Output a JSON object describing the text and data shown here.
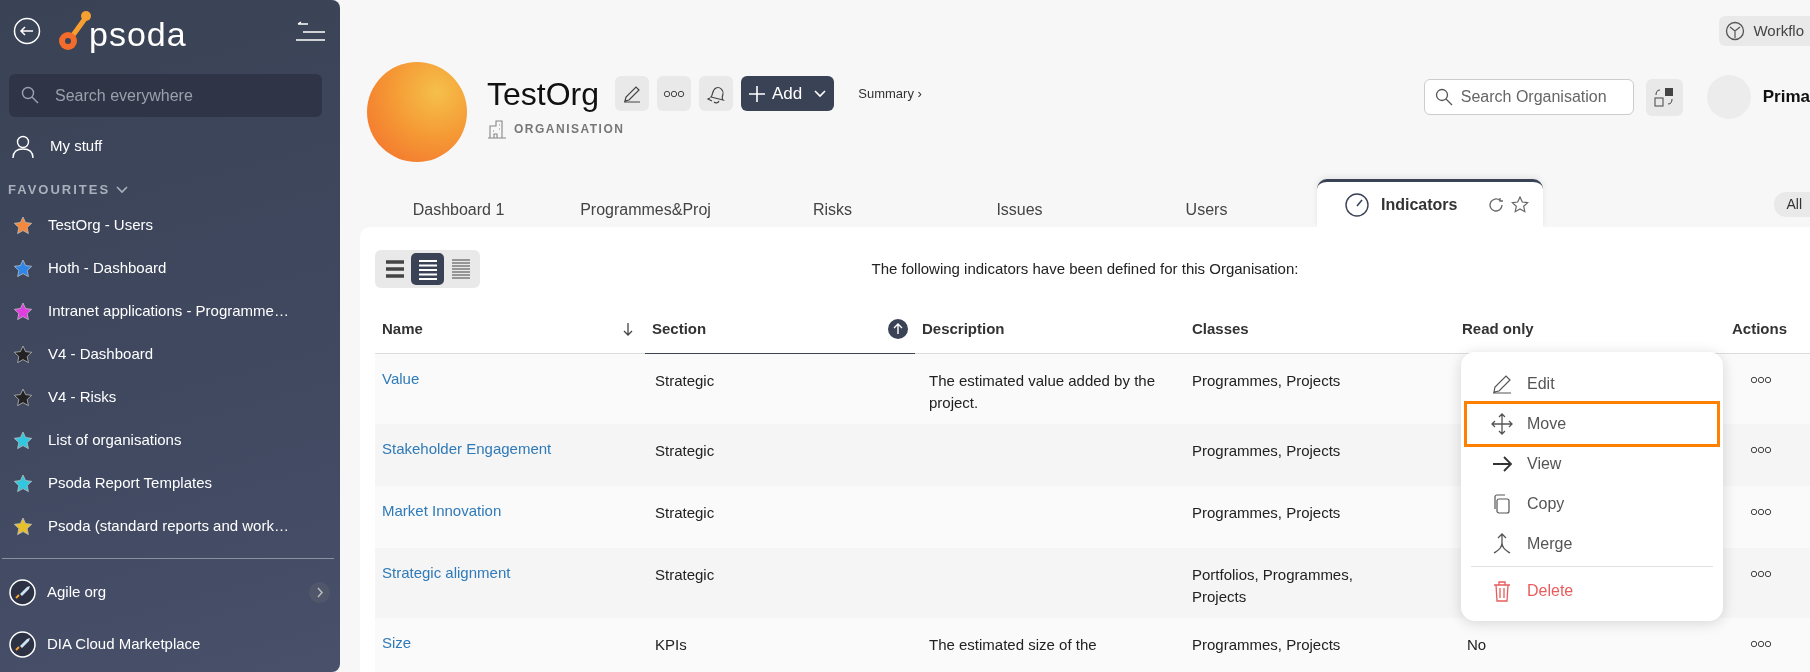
{
  "sidebar": {
    "logo": "psoda",
    "search": {
      "placeholder": "Search everywhere"
    },
    "my_stuff": "My stuff",
    "favourites_heading": "FAVOURITES",
    "favourites": [
      {
        "label": "TestOrg - Users",
        "color": "#f5883a"
      },
      {
        "label": "Hoth - Dashboard",
        "color": "#2e86e8"
      },
      {
        "label": "Intranet applications - Programme…",
        "color": "#e03ee0"
      },
      {
        "label": "V4 - Dashboard",
        "color": "#222222"
      },
      {
        "label": "V4 - Risks",
        "color": "#222222"
      },
      {
        "label": "List of organisations",
        "color": "#30c8e0"
      },
      {
        "label": "Psoda Report Templates",
        "color": "#30c8e0"
      },
      {
        "label": "Psoda (standard reports and work…",
        "color": "#e8c02a"
      }
    ],
    "organisations": [
      {
        "label": "Agile org",
        "expandable": true
      },
      {
        "label": "DIA Cloud Marketplace",
        "expandable": false
      }
    ]
  },
  "header": {
    "workflow_button": "Workflo",
    "title": "TestOrg",
    "type": "ORGANISATION",
    "add_button": "Add",
    "summary_link": "Summary ›",
    "search": {
      "placeholder": "Search Organisation"
    },
    "user_name": "Prima"
  },
  "tabs": [
    {
      "label": "Dashboard 1",
      "selected": false
    },
    {
      "label": "Programmes&Proj",
      "selected": false
    },
    {
      "label": "Risks",
      "selected": false
    },
    {
      "label": "Issues",
      "selected": false
    },
    {
      "label": "Users",
      "selected": false
    },
    {
      "label": "Indicators",
      "selected": true
    }
  ],
  "filter_pill": "All",
  "view_modes": [
    {
      "kind": "large",
      "selected": false
    },
    {
      "kind": "medium",
      "selected": true
    },
    {
      "kind": "small",
      "selected": false
    }
  ],
  "intro": "The following indicators have been defined for this Organisation:",
  "table": {
    "columns": [
      {
        "label": "Name",
        "ascending": false,
        "sorted": false
      },
      {
        "label": "Section",
        "ascending": true,
        "sorted": true
      },
      {
        "label": "Description"
      },
      {
        "label": "Classes"
      },
      {
        "label": "Read only"
      },
      {
        "label": "Actions"
      }
    ],
    "rows": [
      {
        "name": "Value",
        "section": "Strategic",
        "description": "The estimated value added by the project.",
        "classes": "Programmes, Projects"
      },
      {
        "name": "Stakeholder Engagement",
        "section": "Strategic",
        "classes": "Programmes, Projects"
      },
      {
        "name": "Market Innovation",
        "section": "Strategic",
        "classes": "Programmes, Projects"
      },
      {
        "name": "Strategic alignment",
        "section": "Strategic",
        "classes": "Portfolios, Programmes, Projects"
      },
      {
        "name": "Size",
        "section": "KPIs",
        "description": "The estimated size of the",
        "classes": "Programmes, Projects",
        "read_only": "No"
      }
    ]
  },
  "context_menu": {
    "items": [
      {
        "label": "Edit",
        "kind": "edit",
        "highlighted": false
      },
      {
        "label": "Move",
        "kind": "move",
        "highlighted": true
      },
      {
        "label": "View",
        "kind": "view",
        "highlighted": false
      },
      {
        "label": "Copy",
        "kind": "copy",
        "highlighted": false
      },
      {
        "label": "Merge",
        "kind": "merge",
        "highlighted": false
      },
      {
        "label": "Delete",
        "kind": "delete",
        "highlighted": false
      }
    ]
  }
}
